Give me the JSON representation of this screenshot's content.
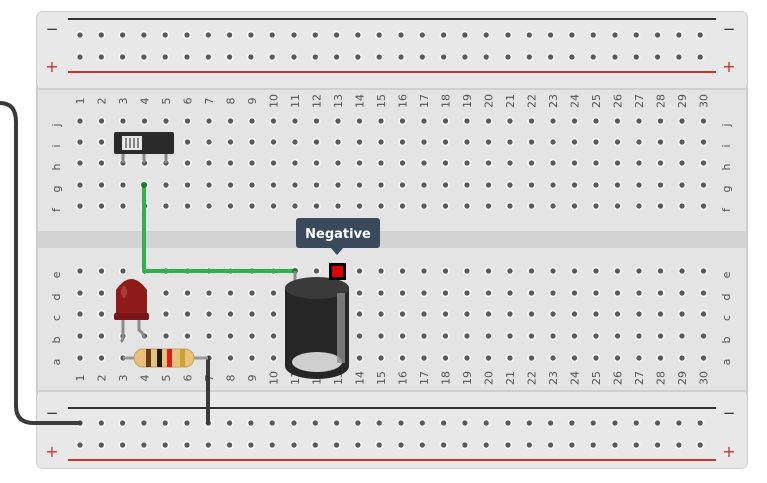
{
  "tooltip": {
    "text": "Negative"
  },
  "columns": [
    "1",
    "2",
    "3",
    "4",
    "5",
    "6",
    "7",
    "8",
    "9",
    "10",
    "11",
    "12",
    "13",
    "14",
    "15",
    "16",
    "17",
    "18",
    "19",
    "20",
    "21",
    "22",
    "23",
    "24",
    "25",
    "26",
    "27",
    "28",
    "29",
    "30"
  ],
  "rows_top": [
    "j",
    "i",
    "h",
    "g",
    "f"
  ],
  "rows_bottom": [
    "e",
    "d",
    "c",
    "b",
    "a"
  ],
  "rails": {
    "negative": "−",
    "positive": "+"
  },
  "colors": {
    "board": "#e4e4e4",
    "board_border": "#cfcfcf",
    "hole": "#595959",
    "wire_green": "#2fb24a",
    "wire_black": "#3a3a3a",
    "rail_negative_line": "#333333",
    "rail_positive_line": "#c0392b",
    "led": "#8e1a1a",
    "probe": "#e00000",
    "tooltip_bg": "#3a4a5c"
  },
  "components": {
    "switch": "slide-switch",
    "led": "red-led",
    "resistor": "resistor",
    "capacitor": "electrolytic-capacitor"
  }
}
